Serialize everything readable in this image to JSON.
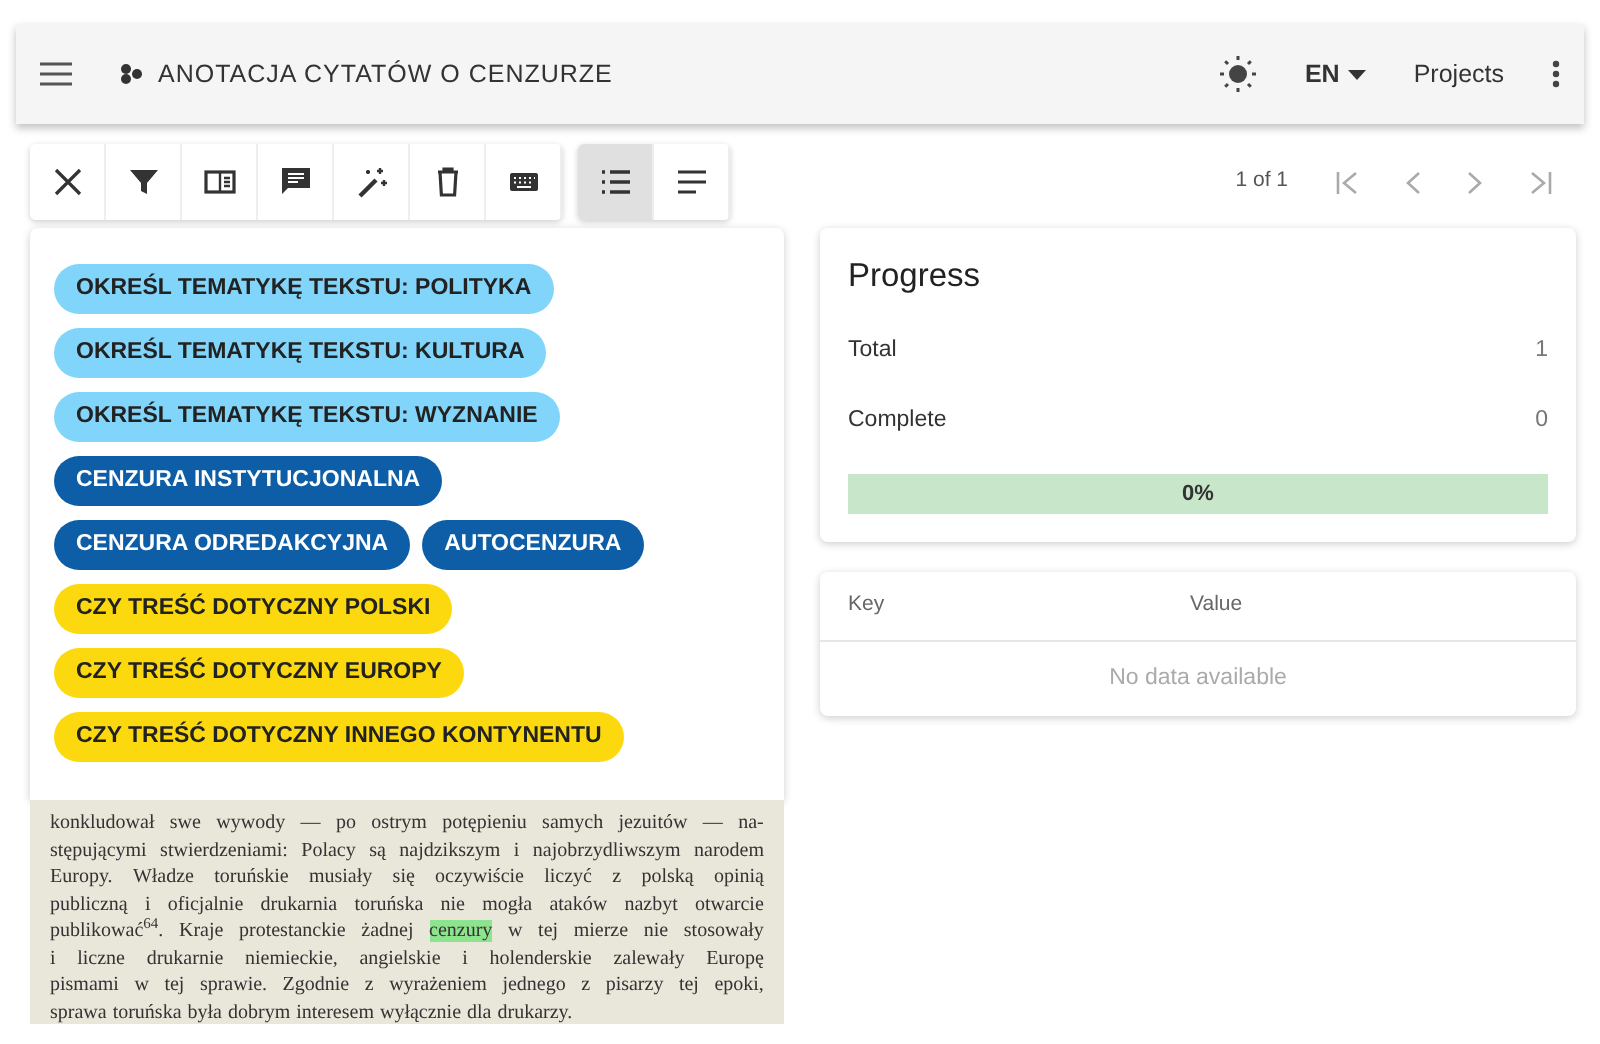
{
  "app_bar": {
    "title": "ANOTACJA CYTATÓW O CENZURZE",
    "language": "EN",
    "projects": "Projects"
  },
  "toolbar": {
    "buttons": [
      {
        "kind": "close"
      },
      {
        "kind": "filter"
      },
      {
        "kind": "panel"
      },
      {
        "kind": "comment"
      },
      {
        "kind": "magic"
      },
      {
        "kind": "delete"
      },
      {
        "kind": "keyboard"
      }
    ],
    "toggles": [
      {
        "kind": "list",
        "selected": true
      },
      {
        "kind": "text",
        "selected": false
      }
    ]
  },
  "pager": {
    "text": "1 of 1"
  },
  "labels": [
    {
      "text": "OKREŚL TEMATYKĘ TEKSTU: POLITYKA",
      "color": "#81d4fa"
    },
    {
      "text": "OKREŚL TEMATYKĘ TEKSTU: KULTURA",
      "color": "#81d4fa"
    },
    {
      "text": "OKREŚL TEMATYKĘ TEKSTU: WYZNANIE",
      "color": "#81d4fa"
    },
    {
      "text": "CENZURA INSTYTUCJONALNA",
      "color": "#0d5ea6"
    },
    {
      "text": "CENZURA ODREDAKCYJNA",
      "color": "#0d5ea6"
    },
    {
      "text": "AUTOCENZURA",
      "color": "#0d5ea6"
    },
    {
      "text": "CZY TREŚĆ DOTYCZNY POLSKI",
      "color": "#fcd80f"
    },
    {
      "text": "CZY TREŚĆ DOTYCZNY EUROPY",
      "color": "#fcd80f"
    },
    {
      "text": "CZY TREŚĆ DOTYCZNY INNEGO KONTYNENTU",
      "color": "#fcd80f"
    }
  ],
  "document": {
    "lines": [
      {
        "parts": [
          {
            "text": "konkludował swe wywody — po ostrym potępieniu samych jezuitów — na-",
            "highlight": false
          }
        ]
      },
      {
        "parts": [
          {
            "text": "stępującymi stwierdzeniami: Polacy są najdzikszym i najobrzydliwszym narodem",
            "highlight": false
          }
        ]
      },
      {
        "parts": [
          {
            "text": "Europy. Władze toruńskie musiały się oczywiście liczyć z polską opinią",
            "highlight": false
          }
        ]
      },
      {
        "parts": [
          {
            "text": "publiczną i oficjalnie drukarnia toruńska nie mogła ataków nazbyt otwarcie",
            "highlight": false
          }
        ]
      },
      {
        "parts": [
          {
            "text": "publikować$^{64}$. Kraje protestanckie żadnej ",
            "highlight": false
          },
          {
            "text": "cenzury",
            "highlight": true
          },
          {
            "text": " w tej mierze nie stosowały",
            "highlight": false
          }
        ]
      },
      {
        "parts": [
          {
            "text": "i liczne drukarnie niemieckie, angielskie i holenderskie zalewały Europę",
            "highlight": false
          }
        ]
      },
      {
        "parts": [
          {
            "text": "pismami w tej sprawie. Zgodnie z wyrażeniem jednego z pisarzy tej epoki,",
            "highlight": false
          }
        ]
      },
      {
        "parts": [
          {
            "text": "sprawa toruńska była dobrym interesem wyłącznie dla drukarzy.",
            "highlight": false
          }
        ]
      }
    ]
  },
  "progress": {
    "title": "Progress",
    "rows": [
      {
        "label": "Total",
        "value": "1"
      },
      {
        "label": "Complete",
        "value": "0"
      }
    ],
    "level": 0,
    "reading": "0%"
  },
  "metadata": {
    "columns": [
      "Key",
      "Value"
    ],
    "empty": "No data available"
  }
}
